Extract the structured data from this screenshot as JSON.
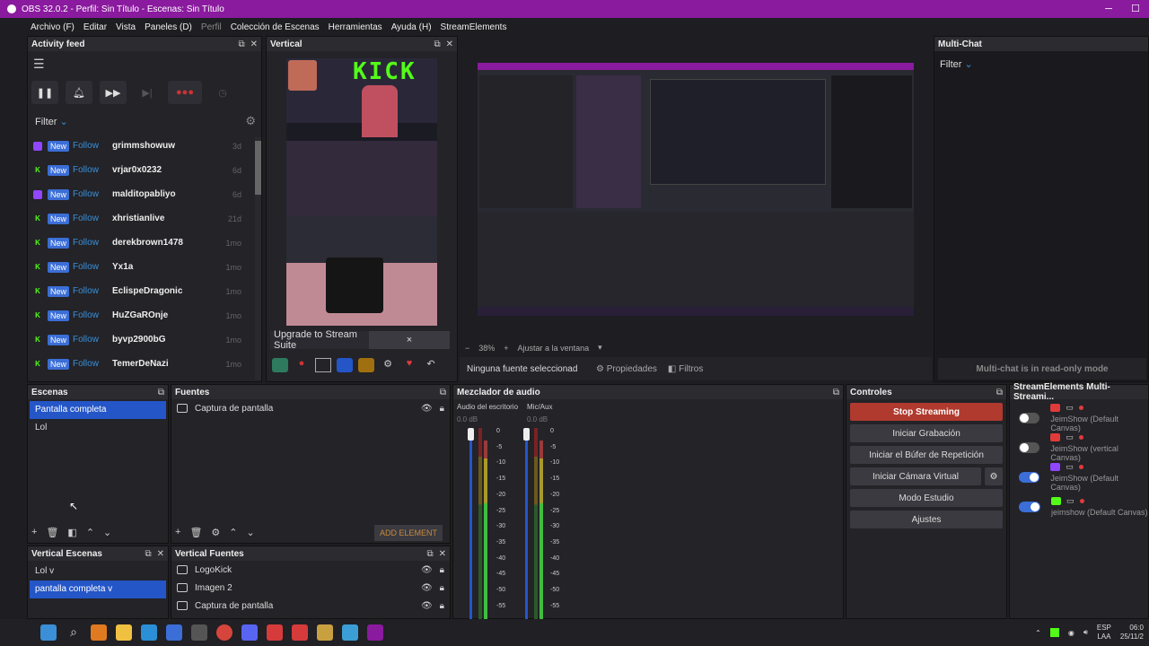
{
  "window": {
    "title": "OBS 32.0.2 - Perfil: Sin Título - Escenas: Sin Título"
  },
  "menu": {
    "items": [
      "Archivo (F)",
      "Editar",
      "Vista",
      "Paneles (D)",
      "Perfil",
      "Colección de Escenas",
      "Herramientas",
      "Ayuda (H)",
      "StreamElements"
    ]
  },
  "activity": {
    "title": "Activity feed",
    "filter": "Filter",
    "new_label": "New",
    "follow_label": "Follow",
    "rows": [
      {
        "plat": "t",
        "name": "grimmshowuw",
        "age": "3d"
      },
      {
        "plat": "k",
        "name": "vrjar0x0232",
        "age": "6d"
      },
      {
        "plat": "t",
        "name": "malditopabliyo",
        "age": "6d"
      },
      {
        "plat": "k",
        "name": "xhristianlive",
        "age": "21d"
      },
      {
        "plat": "k",
        "name": "derekbrown1478",
        "age": "1mo"
      },
      {
        "plat": "k",
        "name": "Yx1a",
        "age": "1mo"
      },
      {
        "plat": "k",
        "name": "EclispeDragonic",
        "age": "1mo"
      },
      {
        "plat": "k",
        "name": "HuZGaROnje",
        "age": "1mo"
      },
      {
        "plat": "k",
        "name": "byvp2900bG",
        "age": "1mo"
      },
      {
        "plat": "k",
        "name": "TemerDeNazi",
        "age": "1mo"
      }
    ]
  },
  "vertical": {
    "title": "Vertical",
    "kick_text": "KICK",
    "upgrade": "Upgrade to Stream Suite",
    "close": "×"
  },
  "preview": {
    "zoom": "38%",
    "fit": "Ajustar a la ventana",
    "no_source": "Ninguna fuente seleccionad",
    "props": "Propiedades",
    "filters": "Filtros"
  },
  "multichat": {
    "title": "Multi-Chat",
    "filter": "Filter",
    "readonly": "Multi-chat is in read-only mode"
  },
  "escenas": {
    "title": "Escenas",
    "items": [
      "Pantalla completa",
      "Lol"
    ]
  },
  "fuentes": {
    "title": "Fuentes",
    "items": [
      "Captura de pantalla"
    ],
    "add": "ADD ELEMENT"
  },
  "mixer": {
    "title": "Mezclador de audio",
    "ch1": "Audio del escritorio",
    "ch2": "Mic/Aux",
    "db1": "0.0 dB",
    "db2": "0.0 dB",
    "ticks": [
      "0",
      "-5",
      "-10",
      "-15",
      "-20",
      "-25",
      "-30",
      "-35",
      "-40",
      "-45",
      "-50",
      "-55"
    ]
  },
  "controles": {
    "title": "Controles",
    "stop": "Stop Streaming",
    "rec": "Iniciar Grabación",
    "replay": "Iniciar el Búfer de Repetición",
    "vcam": "Iniciar Cámara Virtual",
    "studio": "Modo Estudio",
    "settings": "Ajustes"
  },
  "se": {
    "title": "StreamElements Multi-Streami...",
    "rows": [
      {
        "toggle": "off",
        "label": "JeimShow (Default Canvas)"
      },
      {
        "toggle": "off",
        "label": "JeimShow (vertical Canvas)"
      },
      {
        "toggle": "on",
        "label": "JeimShow (Default Canvas)"
      },
      {
        "toggle": "on",
        "label": "jeimshow (Default Canvas)"
      }
    ]
  },
  "vescenas": {
    "title": "Vertical Escenas",
    "items": [
      "Lol v",
      "pantalla completa v"
    ]
  },
  "vfuentes": {
    "title": "Vertical Fuentes",
    "items": [
      "LogoKick",
      "Imagen 2",
      "Captura de pantalla"
    ]
  },
  "taskbar": {
    "lang1": "ESP",
    "lang2": "LAA",
    "time": "06:0",
    "date": "25/11/2"
  },
  "colors": {
    "accent": "#8a1a9e",
    "select": "#2456c8",
    "stop": "#b03a2e",
    "kick": "#53fc18",
    "twitch": "#9146ff"
  }
}
